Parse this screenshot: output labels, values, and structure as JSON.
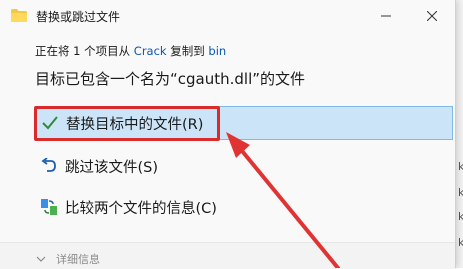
{
  "dialog": {
    "title": "替换或跳过文件",
    "status": {
      "prefix": "正在将 1 个项目从 ",
      "source": "Crack",
      "middle": " 复制到 ",
      "destination": "bin"
    },
    "heading": "目标已包含一个名为“cgauth.dll”的文件",
    "options": [
      {
        "label": "替换目标中的文件(R)",
        "icon": "checkmark-icon"
      },
      {
        "label": "跳过该文件(S)",
        "icon": "undo-arrow-icon"
      },
      {
        "label": "比较两个文件的信息(C)",
        "icon": "compare-icon"
      }
    ],
    "details_label": "详细信息"
  },
  "colors": {
    "accent": "#0a58b5",
    "highlight": "#cce4f7",
    "annotation": "#d92b2b"
  }
}
